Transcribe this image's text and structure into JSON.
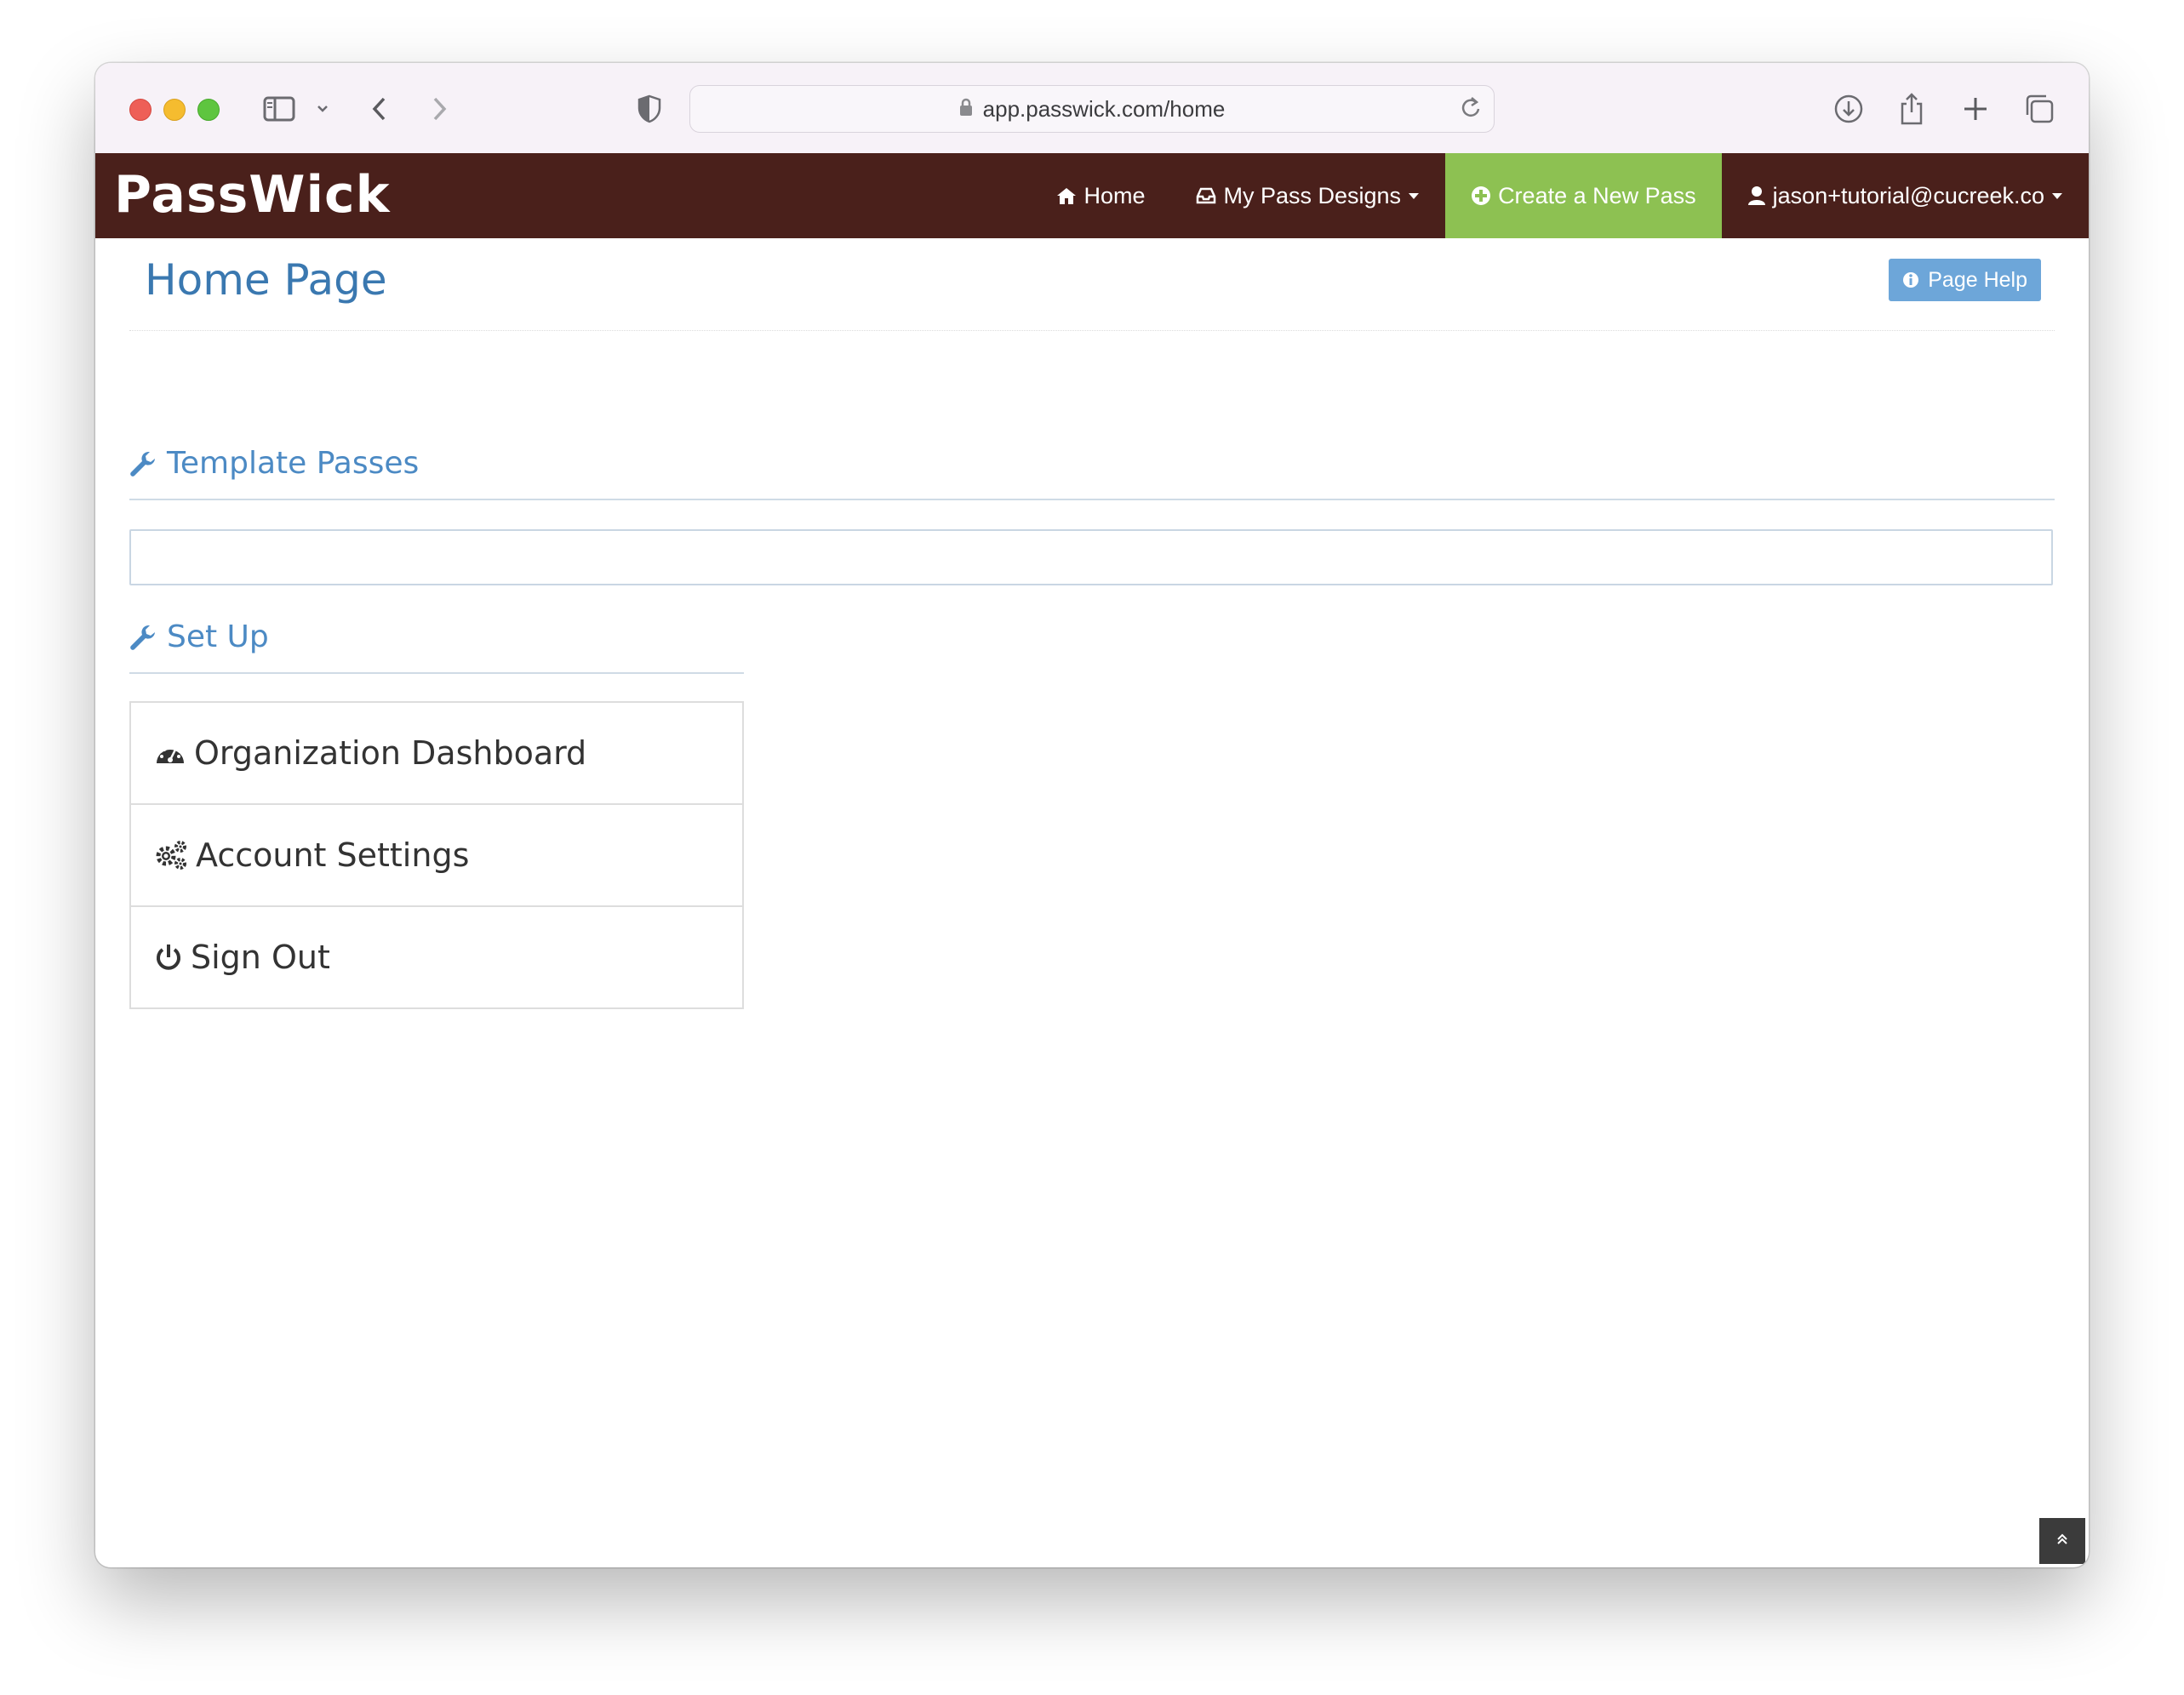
{
  "browser": {
    "url": "app.passwick.com/home"
  },
  "navbar": {
    "logo": "PassWick",
    "items": [
      {
        "label": "Home",
        "icon": "home-icon"
      },
      {
        "label": "My Pass Designs",
        "icon": "inbox-icon"
      },
      {
        "label": "Create a New Pass",
        "icon": "plus-circle-icon"
      },
      {
        "label": "jason+tutorial@cucreek.co",
        "icon": "user-icon"
      }
    ],
    "colors": {
      "background": "#4a201b",
      "create_background": "#8dc152"
    }
  },
  "page": {
    "title": "Home Page",
    "help_label": "Page Help"
  },
  "sections": {
    "template_passes": {
      "title": "Template Passes"
    },
    "set_up": {
      "title": "Set Up",
      "items": [
        {
          "label": "Organization Dashboard",
          "icon": "dashboard-icon"
        },
        {
          "label": "Account Settings",
          "icon": "gears-icon"
        },
        {
          "label": "Sign Out",
          "icon": "power-icon"
        }
      ]
    }
  }
}
